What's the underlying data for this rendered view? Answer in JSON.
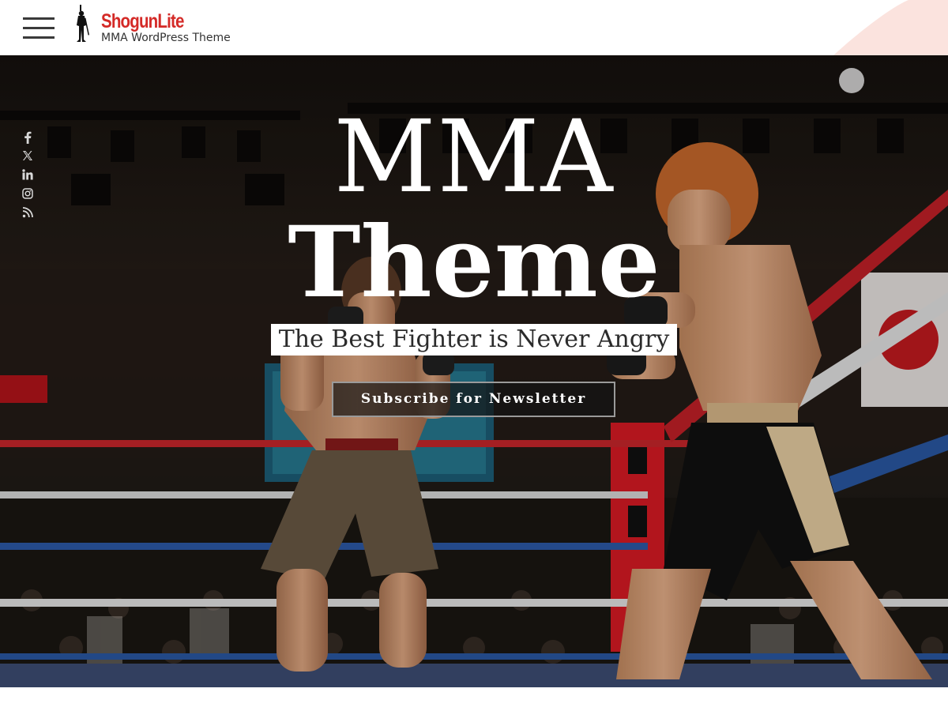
{
  "header": {
    "site_title": "ShogunLite",
    "tagline": "MMA WordPress Theme",
    "accent_color": "#d42a27",
    "menu_icon": "hamburger-icon",
    "logo_icon": "samurai-silhouette-icon"
  },
  "social": [
    {
      "name": "facebook",
      "icon": "facebook-icon"
    },
    {
      "name": "x",
      "icon": "x-twitter-icon"
    },
    {
      "name": "linkedin",
      "icon": "linkedin-icon"
    },
    {
      "name": "instagram",
      "icon": "instagram-icon"
    },
    {
      "name": "rss",
      "icon": "rss-icon"
    }
  ],
  "hero": {
    "title_line1": "MMA",
    "title_line2": "Theme",
    "subtitle": "The Best Fighter is Never Angry",
    "cta_label": "Subscribe for Newsletter",
    "background": "mma-fight-photo"
  }
}
